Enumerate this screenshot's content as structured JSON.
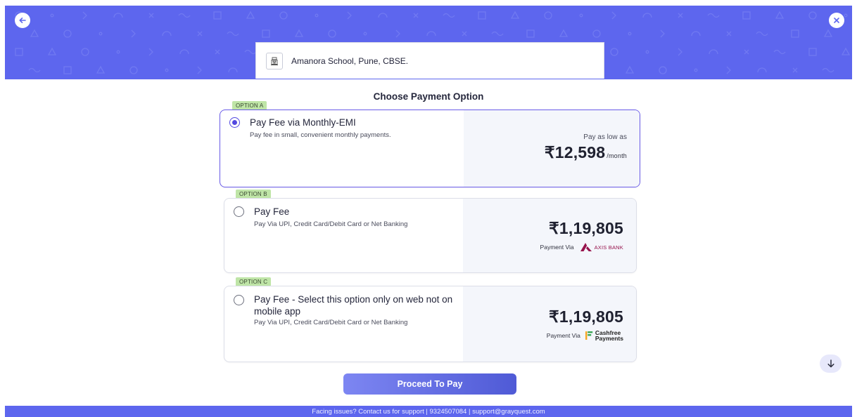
{
  "header": {
    "back_icon": "arrow-left-icon",
    "close_icon": "close-icon",
    "school_icon": "school-building-icon",
    "school_name": "Amanora School, Pune, CBSE.",
    "colors": {
      "banner": "#5d66ee",
      "accent": "#5349e0"
    }
  },
  "title": "Choose Payment Option",
  "options": [
    {
      "tag": "OPTION A",
      "title": "Pay Fee via Monthly-EMI",
      "description": "Pay fee in small, convenient monthly payments.",
      "pay_as_low_as": "Pay as low as",
      "amount": "₹12,598",
      "per": "/month",
      "selected": true
    },
    {
      "tag": "OPTION B",
      "title": "Pay Fee",
      "description": "Pay Via UPI, Credit Card/Debit Card or Net Banking",
      "amount": "₹1,19,805",
      "payment_via": "Payment Via",
      "provider": "AXIS BANK",
      "provider_icon": "axis-bank-logo",
      "selected": false
    },
    {
      "tag": "OPTION C",
      "title": "Pay Fee - Select this option only on web not on mobile app",
      "description": "Pay Via UPI, Credit Card/Debit Card or Net Banking",
      "amount": "₹1,19,805",
      "payment_via": "Payment Via",
      "provider_line1": "Cashfree",
      "provider_line2": "Payments",
      "provider_icon": "cashfree-payments-logo",
      "selected": false
    }
  ],
  "scroll_icon": "arrow-down-icon",
  "proceed_label": "Proceed To Pay",
  "footer": "Facing issues? Contact us for support | 9324507084 | support@grayquest.com"
}
